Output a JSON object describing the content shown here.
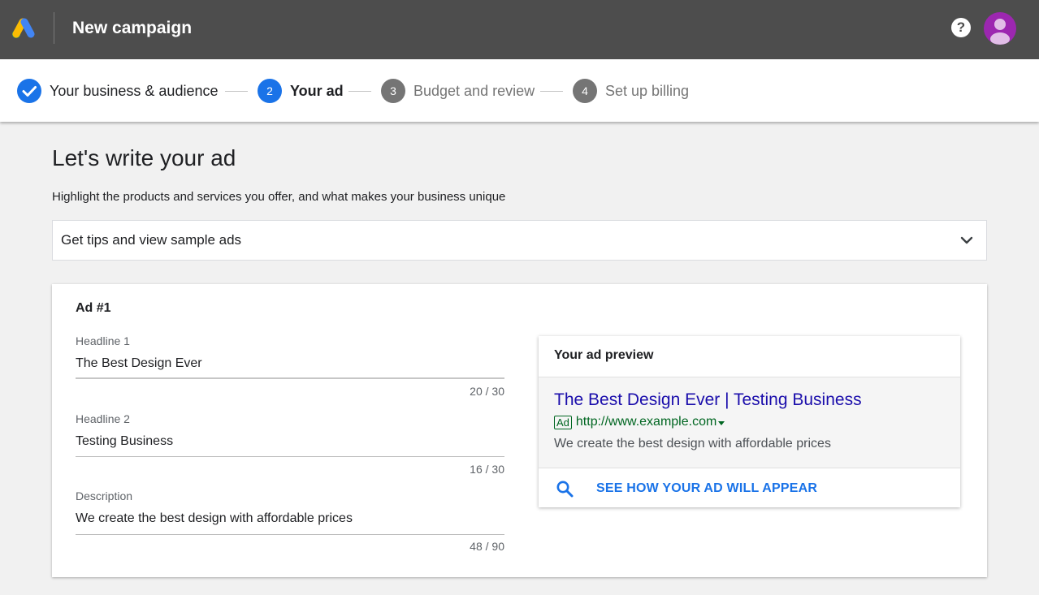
{
  "app": {
    "title": "New campaign",
    "help_icon": "help-icon",
    "logo_icon": "google-ads-logo-icon",
    "avatar_icon": "account-avatar-icon"
  },
  "stepper": {
    "steps": [
      {
        "number": "",
        "label": "Your business & audience",
        "state": "completed"
      },
      {
        "number": "2",
        "label": "Your ad",
        "state": "active"
      },
      {
        "number": "3",
        "label": "Budget and review",
        "state": "upcoming"
      },
      {
        "number": "4",
        "label": "Set up billing",
        "state": "upcoming"
      }
    ]
  },
  "page": {
    "title": "Let's write your ad",
    "subtitle": "Highlight the products and services you offer, and what makes your business unique"
  },
  "tips": {
    "label": "Get tips and view sample ads",
    "icon": "chevron-down-icon"
  },
  "ad": {
    "heading": "Ad #1",
    "fields": [
      {
        "label": "Headline 1",
        "value": "The Best Design Ever",
        "count": "20 / 30"
      },
      {
        "label": "Headline 2",
        "value": "Testing Business",
        "count": "16 / 30"
      },
      {
        "label": "Description",
        "value": "We create the best design with affordable prices",
        "count": "48 / 90"
      }
    ]
  },
  "preview": {
    "title": "Your ad preview",
    "headline": "The Best Design Ever | Testing Business",
    "badge": "Ad",
    "url": "http://www.example.com",
    "description": "We create the best design with affordable prices",
    "action_label": "SEE HOW YOUR AD WILL APPEAR",
    "action_icon": "search-icon"
  },
  "colors": {
    "topbar": "#4d4d4d",
    "accent": "#1a73e8",
    "step_inactive": "#757575",
    "ad_headline": "#1a0dab",
    "ad_url": "#006621",
    "avatar": "#9c27b0"
  }
}
